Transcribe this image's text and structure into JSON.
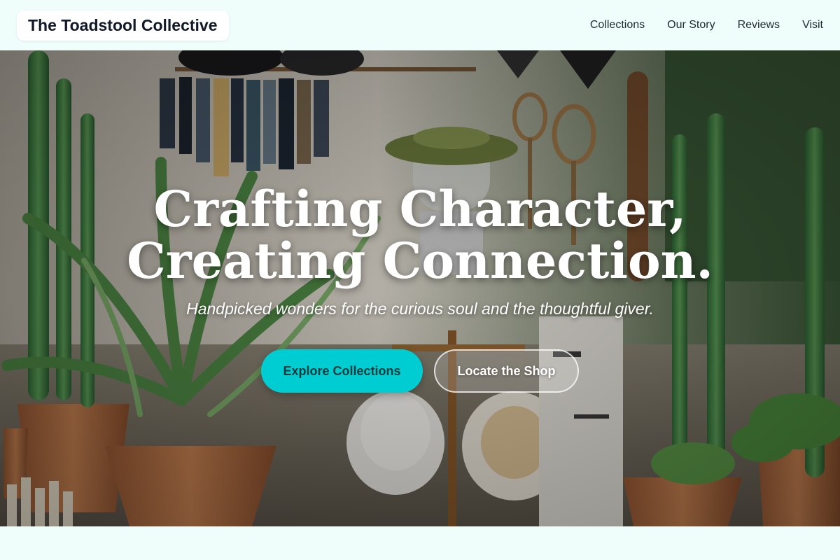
{
  "header": {
    "logo_text": "The Toadstool Collective",
    "nav": [
      {
        "label": "Collections"
      },
      {
        "label": "Our Story"
      },
      {
        "label": "Reviews"
      },
      {
        "label": "Visit"
      }
    ]
  },
  "hero": {
    "title_line1": "Crafting Character,",
    "title_line2": "Creating Connection.",
    "tagline": "Handpicked wonders for the curious soul and the thoughtful giver.",
    "primary_button": "Explore Collections",
    "secondary_button": "Locate the Shop"
  },
  "colors": {
    "accent": "#00cdd1",
    "header_bg": "#effdfb",
    "text_dark": "#1f2937"
  }
}
